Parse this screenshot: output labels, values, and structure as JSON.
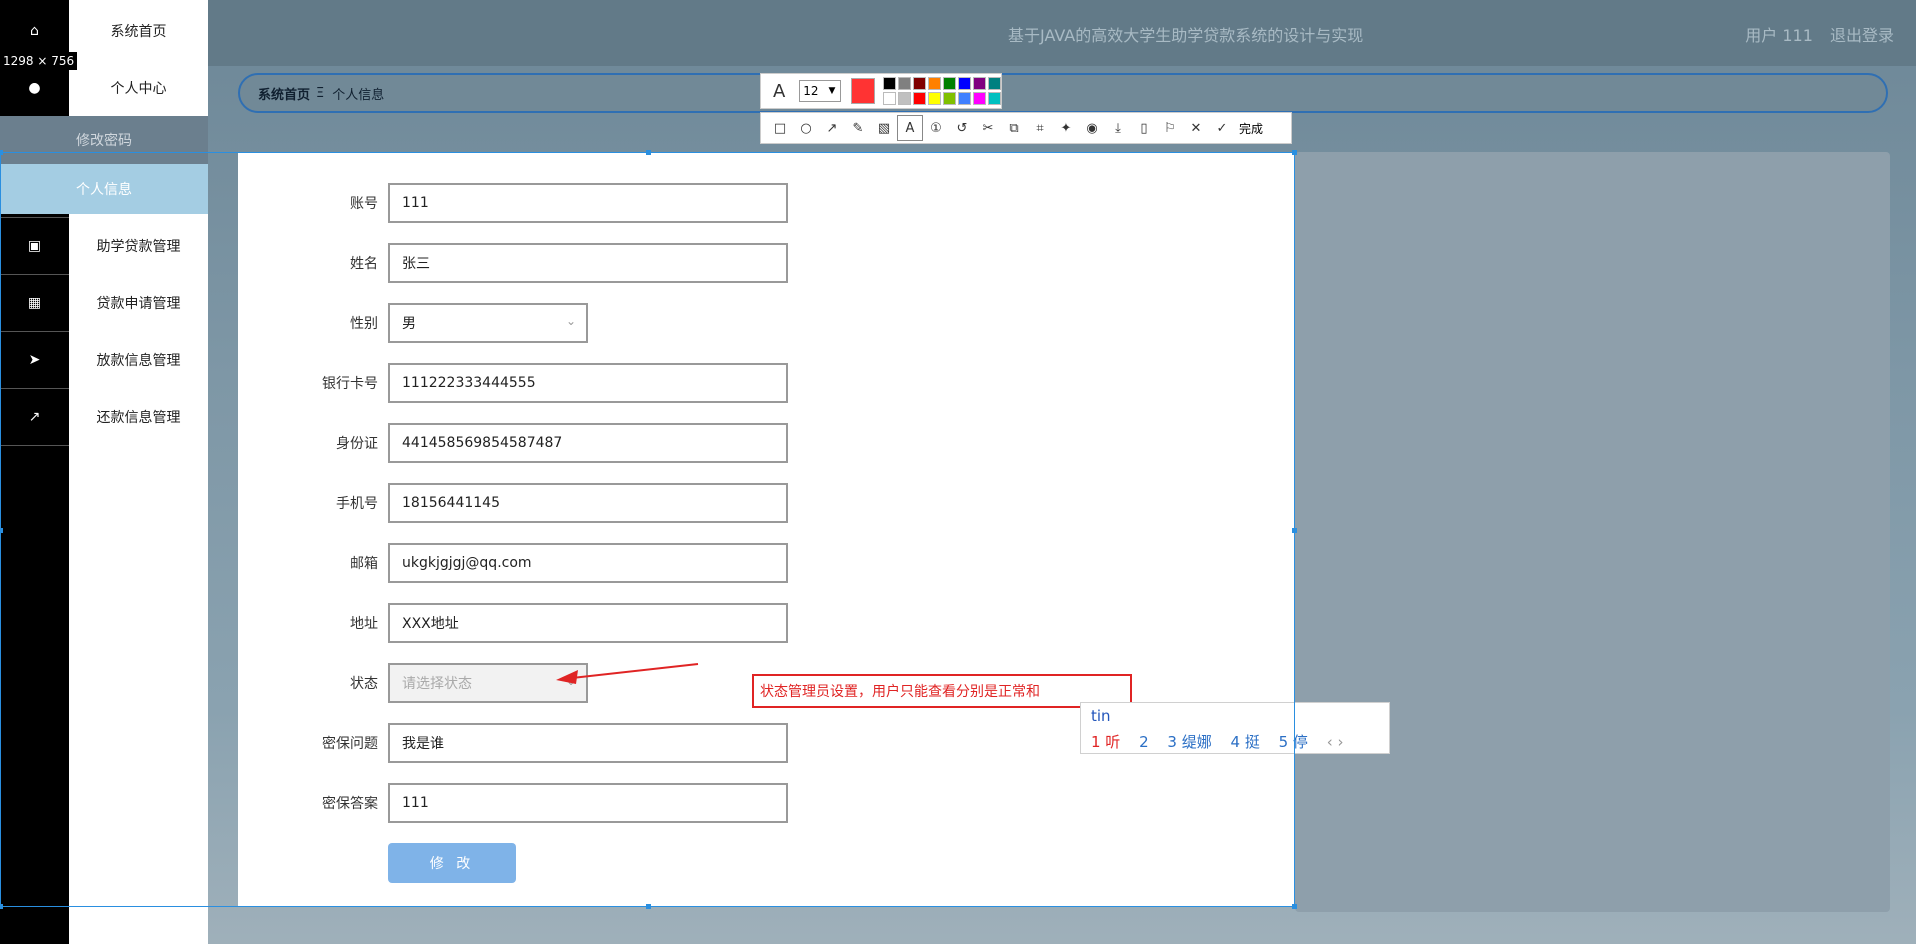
{
  "header": {
    "title": "基于JAVA的高效大学生助学贷款系统的设计与实现",
    "user": "用户 111",
    "logout": "退出登录"
  },
  "selection_size": "1298 × 756",
  "sidebar": {
    "top_items": [
      {
        "label": "系统首页",
        "icon": "home-icon"
      },
      {
        "label": "个人中心",
        "icon": "user-icon"
      }
    ],
    "sub_items": [
      {
        "label": "修改密码"
      },
      {
        "label": "个人信息"
      }
    ],
    "items": [
      {
        "label": "助学贷款管理",
        "icon": "clipboard-icon"
      },
      {
        "label": "贷款申请管理",
        "icon": "grid-icon"
      },
      {
        "label": "放款信息管理",
        "icon": "paper-plane-icon"
      },
      {
        "label": "还款信息管理",
        "icon": "chart-icon"
      }
    ]
  },
  "breadcrumb": {
    "home": "系统首页",
    "separator": "Ξ",
    "current": "个人信息"
  },
  "form": {
    "fields": [
      {
        "label": "账号",
        "value": "111"
      },
      {
        "label": "姓名",
        "value": "张三"
      },
      {
        "label": "性别",
        "value": "男"
      },
      {
        "label": "银行卡号",
        "value": "111222333444555"
      },
      {
        "label": "身份证",
        "value": "441458569854587487"
      },
      {
        "label": "手机号",
        "value": "18156441145"
      },
      {
        "label": "邮箱",
        "value": "ukgkjgjgj@qq.com"
      },
      {
        "label": "地址",
        "value": "XXX地址"
      },
      {
        "label": "状态",
        "placeholder": "请选择状态"
      },
      {
        "label": "密保问题",
        "value": "我是谁"
      },
      {
        "label": "密保答案",
        "value": "111"
      }
    ],
    "submit": "修 改"
  },
  "annotation": {
    "text": "状态管理员设置，用户只能查看分别是正常和"
  },
  "ime": {
    "input": "tin",
    "candidates": [
      "1 听",
      "2",
      "3 缇娜",
      "4 挺",
      "5 停"
    ],
    "nav": "‹ ›"
  },
  "toolbar": {
    "font_size": "12",
    "current_color": "#ff3333",
    "palette": [
      "#000000",
      "#808080",
      "#800000",
      "#ff8000",
      "#008000",
      "#0000ff",
      "#800080",
      "#008080",
      "#ffffff",
      "#c0c0c0",
      "#ff0000",
      "#ffff00",
      "#80c000",
      "#4080ff",
      "#ff00ff",
      "#00c0c0"
    ],
    "done": "完成"
  }
}
